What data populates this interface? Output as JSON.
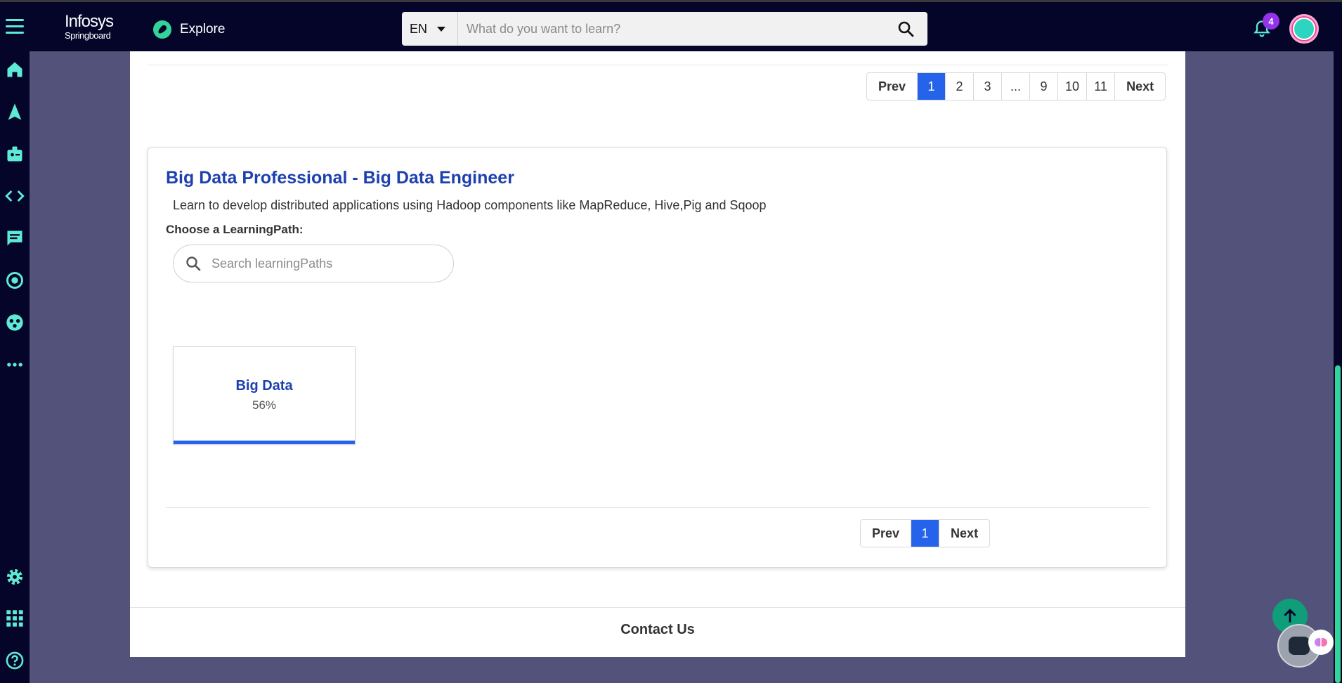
{
  "header": {
    "logo_line1": "Infosys",
    "logo_line2": "Springboard",
    "explore_label": "Explore",
    "language": "EN",
    "search_placeholder": "What do you want to learn?",
    "notification_count": "4"
  },
  "sidebar": {
    "items": [
      "home-icon",
      "navigate-icon",
      "badge-icon",
      "code-icon",
      "chat-icon",
      "target-icon",
      "community-icon",
      "more-icon"
    ],
    "bottom_items": [
      "settings-icon",
      "apps-grid-icon",
      "help-icon"
    ]
  },
  "top_pager": {
    "prev": "Prev",
    "pages": [
      "1",
      "2",
      "3",
      "...",
      "9",
      "10",
      "11"
    ],
    "active": "1",
    "next": "Next"
  },
  "card": {
    "title": "Big Data Professional - Big Data Engineer",
    "description": "Learn to develop distributed applications using Hadoop components like MapReduce, Hive,Pig and Sqoop",
    "choose_label": "Choose a LearningPath:",
    "search_placeholder": "Search learningPaths",
    "learning_paths": [
      {
        "name": "Big Data",
        "progress_text": "56%"
      }
    ],
    "pager": {
      "prev": "Prev",
      "page": "1",
      "next": "Next"
    }
  },
  "footer": {
    "contact": "Contact Us"
  },
  "colors": {
    "nav_bg": "#05052a",
    "accent": "#5eead4",
    "primary_blue": "#2563eb",
    "title_blue": "#1e40af",
    "page_bg": "#52527a"
  }
}
